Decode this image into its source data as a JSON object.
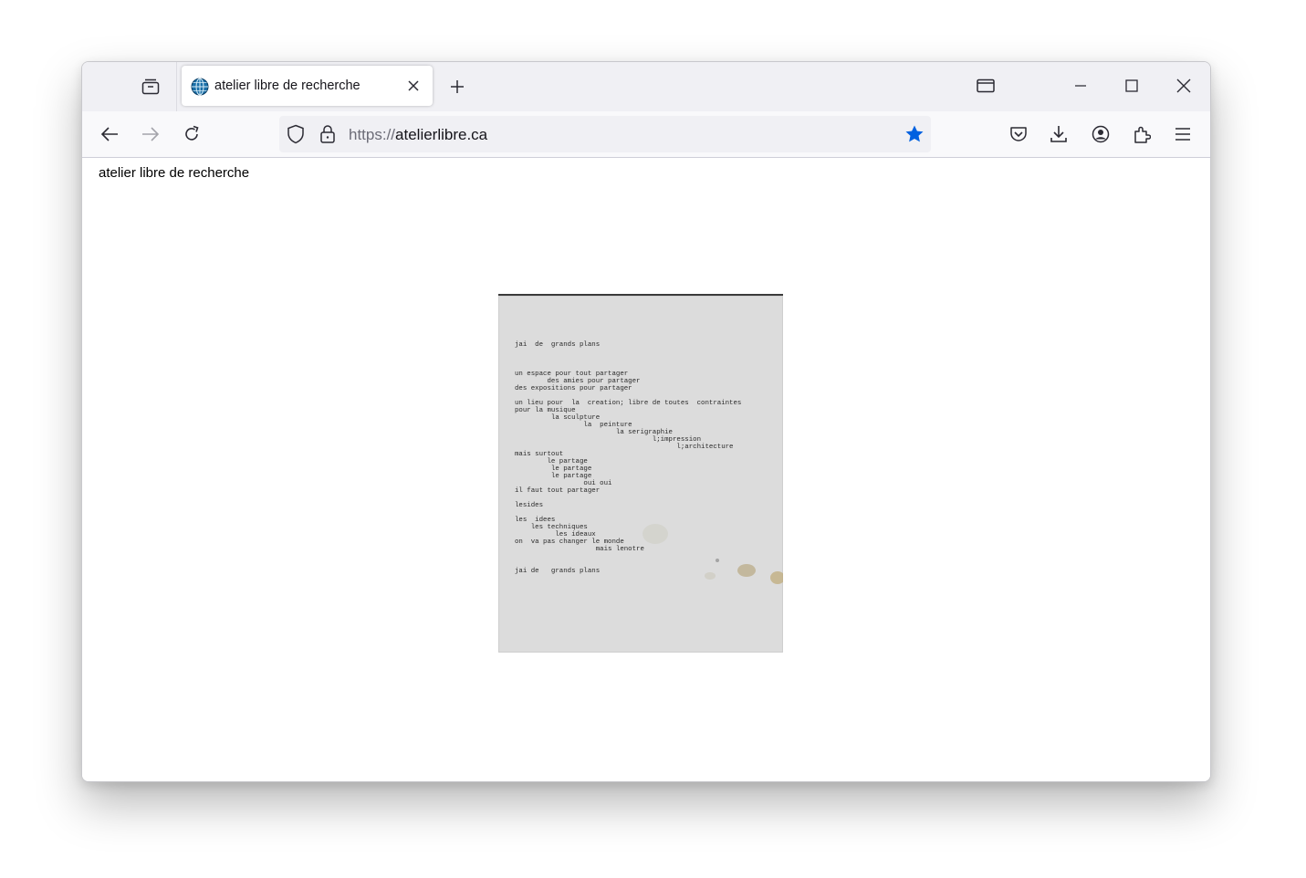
{
  "tab": {
    "title": "atelier libre de recherche",
    "favicon": "globe-icon"
  },
  "address_bar": {
    "protocol": "https://",
    "domain": "atelierlibre.ca",
    "bookmark_icon": "star-filled-icon",
    "accent": "#0061e0"
  },
  "toolbar": {
    "left_icons": [
      "back-arrow-icon",
      "forward-arrow-icon",
      "reload-icon"
    ],
    "right_icons": [
      "pocket-icon",
      "download-icon",
      "account-icon",
      "extensions-icon",
      "menu-icon"
    ]
  },
  "page": {
    "site_title": "atelier libre de recherche",
    "poem_lines": [
      "jai  de  grands plans",
      "",
      "",
      "",
      "un espace pour tout partager",
      "        des amies pour partager",
      "des expositions pour partager",
      "",
      "un lieu pour  la  creation; libre de toutes  contraintes",
      "pour la musique",
      "         la sculpture",
      "                 la  peinture",
      "                         la serigraphie",
      "                                  l;impression",
      "                                        l;architecture",
      "mais surtout",
      "        le partage",
      "         le partage",
      "         le partage",
      "                 oui oui",
      "il faut tout partager",
      "",
      "lesides",
      "",
      "les  idees",
      "    les techniques",
      "          les ideaux",
      "on  va pas changer le monde",
      "                    mais lenotre",
      "",
      "",
      "jai de   grands plans"
    ]
  }
}
